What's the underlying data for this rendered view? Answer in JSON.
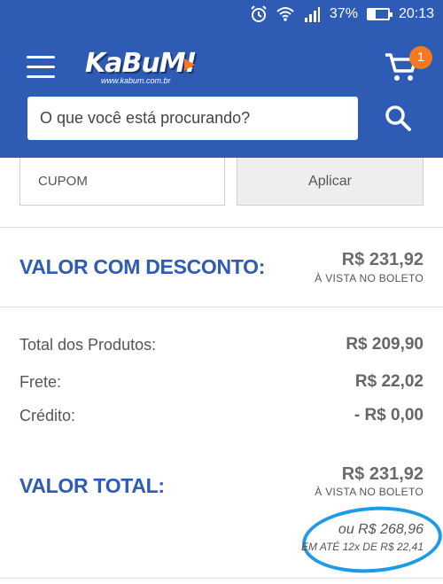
{
  "status_bar": {
    "battery": "37%",
    "battery_level": 0.37,
    "time": "20:13"
  },
  "header": {
    "logo_text": "KaBuM!",
    "logo_url_text": "www.kabum.com.br",
    "cart_count": "1",
    "search_placeholder": "O que você está procurando?",
    "colors": {
      "header_bg": "#2e5bb4",
      "badge": "#f47920"
    },
    "icons": [
      "menu-icon",
      "cart-icon",
      "search-icon",
      "alarm-icon",
      "wifi-icon",
      "signal-icon",
      "battery-icon"
    ]
  },
  "coupon": {
    "placeholder": "CUPOM",
    "apply_label": "Aplicar"
  },
  "discount": {
    "label": "VALOR COM DESCONTO:",
    "price": "R$ 231,92",
    "note": "À VISTA NO BOLETO"
  },
  "summary": {
    "rows": [
      {
        "label": "Total dos Produtos:",
        "value": "R$ 209,90"
      },
      {
        "label": "Frete:",
        "value": "R$ 22,02"
      },
      {
        "label": "Crédito:",
        "value": "- R$ 0,00"
      }
    ]
  },
  "total": {
    "label": "VALOR TOTAL:",
    "price": "R$ 231,92",
    "note": "À VISTA NO BOLETO",
    "installment_price": "ou R$ 268,96",
    "installment_note": "EM ATÉ 12x DE R$ 22,41"
  }
}
